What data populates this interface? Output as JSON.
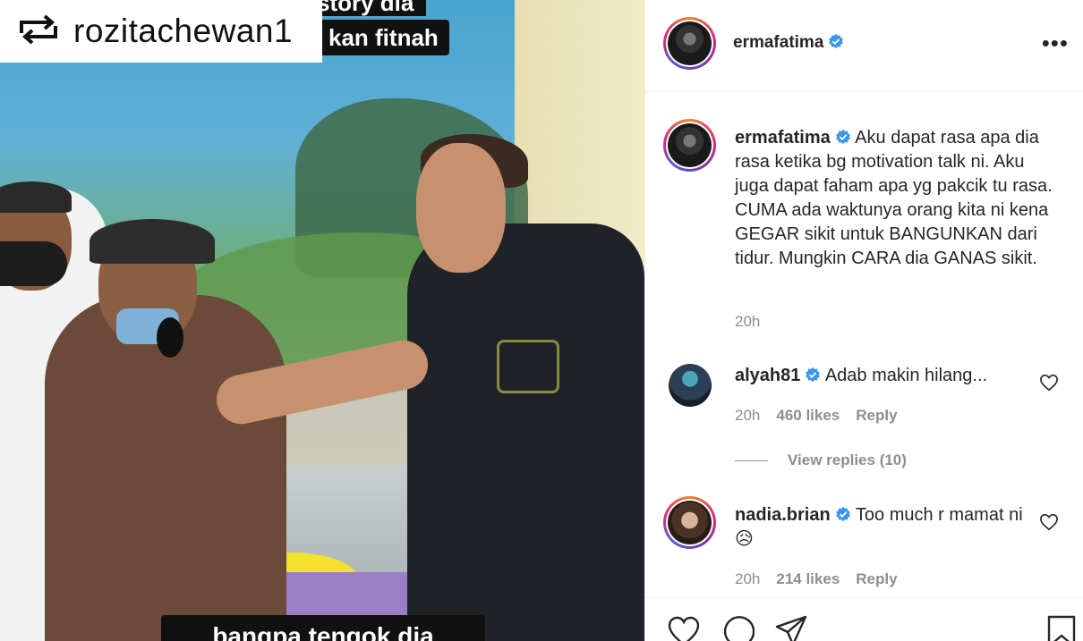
{
  "media": {
    "repost_username": "rozitachewan1",
    "overlay_top_text_1": "story dia",
    "overlay_top_text_2": "kan fitnah",
    "overlay_bottom_text": "bangpa tengok dia"
  },
  "post": {
    "author": "ermafatima",
    "verified": true,
    "more_icon": "ellipsis-icon",
    "caption": "Aku dapat rasa apa dia rasa ketika bg motivation talk ni. Aku juga dapat faham apa yg pakcik tu rasa. CUMA ada waktunya orang kita ni kena GEGAR sikit untuk BANGUNKAN dari tidur. Mungkin CARA dia GANAS sikit.",
    "caption_time": "20h"
  },
  "comments": [
    {
      "username": "alyah81",
      "verified": true,
      "text": "Adab makin hilang...",
      "time": "20h",
      "likes": "460 likes",
      "reply_label": "Reply",
      "view_replies": "View replies (10)"
    },
    {
      "username": "nadia.brian",
      "verified": true,
      "text": "Too much r mamat ni😥",
      "time": "20h",
      "likes": "214 likes",
      "reply_label": "Reply"
    }
  ],
  "actions": [
    "heart-icon",
    "comment-icon",
    "share-icon",
    "bookmark-icon"
  ],
  "colors": {
    "verified_blue": "#3897f0",
    "meta_grey": "#8e8e8e",
    "text": "#262626"
  }
}
